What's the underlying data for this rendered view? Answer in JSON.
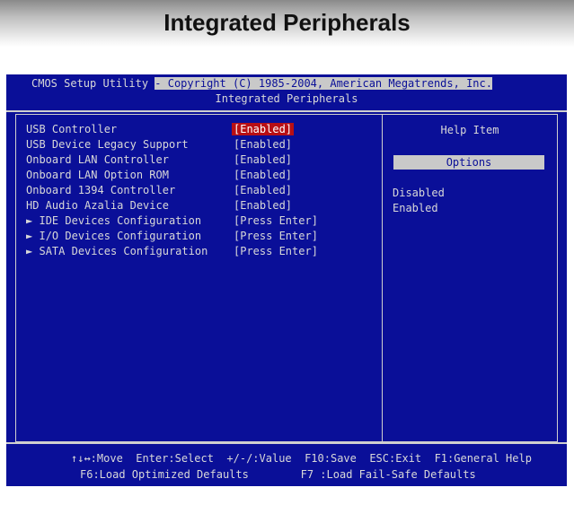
{
  "document": {
    "title": "Integrated Peripherals"
  },
  "bios": {
    "header": {
      "line1_a": "CMOS Setup Utility ",
      "line1_b": "- Copyright (C) 1985-2004, American Megatrends, Inc.",
      "subtitle": "Integrated Peripherals"
    },
    "settings": [
      {
        "label": "USB Controller",
        "value": "[Enabled]",
        "selected": true
      },
      {
        "label": "USB Device Legacy Support",
        "value": "[Enabled]"
      },
      {
        "label": "Onboard LAN Controller",
        "value": "[Enabled]"
      },
      {
        "label": "Onboard LAN Option ROM",
        "value": "[Enabled]"
      },
      {
        "label": "Onboard 1394 Controller",
        "value": "[Enabled]"
      },
      {
        "label": "HD Audio Azalia Device",
        "value": "[Enabled]"
      },
      {
        "label": "IDE Devices Configuration",
        "value": "[Press Enter]",
        "submenu": true
      },
      {
        "label": "I/O Devices Configuration",
        "value": "[Press Enter]",
        "submenu": true
      },
      {
        "label": "SATA Devices Configuration",
        "value": "[Press Enter]",
        "submenu": true
      }
    ],
    "submenu_marker": "►",
    "help": {
      "title": "Help Item",
      "options_heading": "Options",
      "options": [
        "Disabled",
        "Enabled"
      ]
    },
    "footer": {
      "line1": "↑↓↔:Move  Enter:Select  +/-/:Value  F10:Save  ESC:Exit  F1:General Help",
      "line2": "F6:Load Optimized Defaults        F7 :Load Fail-Safe Defaults"
    },
    "colors": {
      "background": "#0a0f98",
      "selection": "#b80f14",
      "text": "#d8d8d8"
    }
  }
}
